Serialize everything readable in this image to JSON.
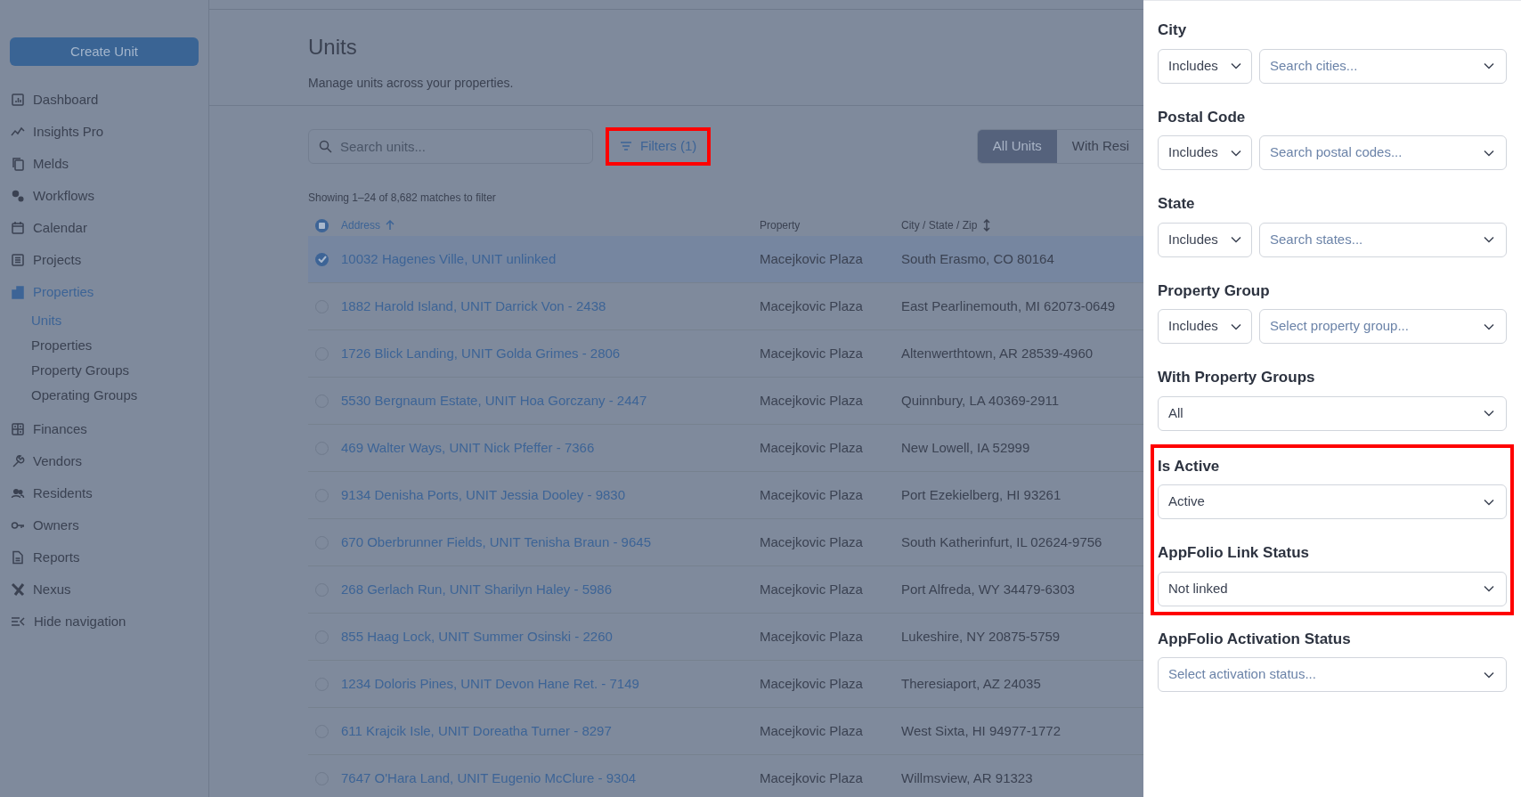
{
  "sidebar": {
    "create_button": "Create Unit",
    "items": [
      {
        "label": "Dashboard",
        "selected": false
      },
      {
        "label": "Insights Pro",
        "selected": false
      },
      {
        "label": "Melds",
        "selected": false
      },
      {
        "label": "Workflows",
        "selected": false
      },
      {
        "label": "Calendar",
        "selected": false
      },
      {
        "label": "Projects",
        "selected": false
      },
      {
        "label": "Properties",
        "selected": true,
        "children": [
          {
            "label": "Units",
            "selected": true
          },
          {
            "label": "Properties",
            "selected": false
          },
          {
            "label": "Property Groups",
            "selected": false
          },
          {
            "label": "Operating Groups",
            "selected": false
          }
        ]
      },
      {
        "label": "Finances",
        "selected": false
      },
      {
        "label": "Vendors",
        "selected": false
      },
      {
        "label": "Residents",
        "selected": false
      },
      {
        "label": "Owners",
        "selected": false
      },
      {
        "label": "Reports",
        "selected": false
      },
      {
        "label": "Nexus",
        "selected": false
      }
    ],
    "hide_navigation": "Hide navigation"
  },
  "page": {
    "title": "Units",
    "subtitle": "Manage units across your properties."
  },
  "toolbar": {
    "search_placeholder": "Search units...",
    "filters_button": {
      "label": "Filters (1)",
      "highlighted": true
    },
    "tabs": [
      {
        "label": "All Units",
        "selected": true
      },
      {
        "label": "With Resi",
        "selected": false
      }
    ]
  },
  "result_count": "Showing 1–24 of 8,682 matches to filter",
  "table": {
    "select_all_partial": true,
    "columns": [
      {
        "label": "Address",
        "sorted_ascending": true,
        "sortable": true
      },
      {
        "label": "Property",
        "sorted_ascending": false,
        "sortable": false
      },
      {
        "label": "City / State / Zip",
        "sorted_ascending": false,
        "sortable": true
      }
    ],
    "rows": [
      {
        "address": "10032 Hagenes Ville, UNIT unlinked",
        "property": "Macejkovic Plaza",
        "city": "South Erasmo, CO 80164",
        "selected": true
      },
      {
        "address": "1882 Harold Island, UNIT Darrick Von - 2438",
        "property": "Macejkovic Plaza",
        "city": "East Pearlinemouth, MI 62073-0649",
        "selected": false
      },
      {
        "address": "1726 Blick Landing, UNIT Golda Grimes - 2806",
        "property": "Macejkovic Plaza",
        "city": "Altenwerthtown, AR 28539-4960",
        "selected": false
      },
      {
        "address": "5530 Bergnaum Estate, UNIT Hoa Gorczany - 2447",
        "property": "Macejkovic Plaza",
        "city": "Quinnbury, LA 40369-2911",
        "selected": false
      },
      {
        "address": "469 Walter Ways, UNIT Nick Pfeffer - 7366",
        "property": "Macejkovic Plaza",
        "city": "New Lowell, IA 52999",
        "selected": false
      },
      {
        "address": "9134 Denisha Ports, UNIT Jessia Dooley - 9830",
        "property": "Macejkovic Plaza",
        "city": "Port Ezekielberg, HI 93261",
        "selected": false
      },
      {
        "address": "670 Oberbrunner Fields, UNIT Tenisha Braun - 9645",
        "property": "Macejkovic Plaza",
        "city": "South Katherinfurt, IL 02624-9756",
        "selected": false
      },
      {
        "address": "268 Gerlach Run, UNIT Sharilyn Haley - 5986",
        "property": "Macejkovic Plaza",
        "city": "Port Alfreda, WY 34479-6303",
        "selected": false
      },
      {
        "address": "855 Haag Lock, UNIT Summer Osinski - 2260",
        "property": "Macejkovic Plaza",
        "city": "Lukeshire, NY 20875-5759",
        "selected": false
      },
      {
        "address": "1234 Doloris Pines, UNIT Devon Hane Ret. - 7149",
        "property": "Macejkovic Plaza",
        "city": "Theresiaport, AZ 24035",
        "selected": false
      },
      {
        "address": "611 Krajcik Isle, UNIT Doreatha Turner - 8297",
        "property": "Macejkovic Plaza",
        "city": "West Sixta, HI 94977-1772",
        "selected": false
      },
      {
        "address": "7647 O'Hara Land, UNIT Eugenio McClure - 9304",
        "property": "Macejkovic Plaza",
        "city": "Willmsview, AR 91323",
        "selected": false
      }
    ]
  },
  "filter_panel": {
    "filters": [
      {
        "label": "City",
        "kind": "operator",
        "operator": "Includes",
        "placeholder": "Search cities...",
        "highlighted": false
      },
      {
        "label": "Postal Code",
        "kind": "operator",
        "operator": "Includes",
        "placeholder": "Search postal codes...",
        "highlighted": false
      },
      {
        "label": "State",
        "kind": "operator",
        "operator": "Includes",
        "placeholder": "Search states...",
        "highlighted": false
      },
      {
        "label": "Property Group",
        "kind": "operator",
        "operator": "Includes",
        "placeholder": "Select property group...",
        "highlighted": false
      },
      {
        "label": "With Property Groups",
        "kind": "select",
        "value": "All",
        "highlighted": false
      },
      {
        "label": "Is Active",
        "kind": "select",
        "value": "Active",
        "highlighted": true
      },
      {
        "label": "AppFolio Link Status",
        "kind": "select",
        "value": "Not linked",
        "highlighted": true
      },
      {
        "label": "AppFolio Activation Status",
        "kind": "select",
        "placeholder": "Select activation status...",
        "highlighted": false
      }
    ]
  }
}
